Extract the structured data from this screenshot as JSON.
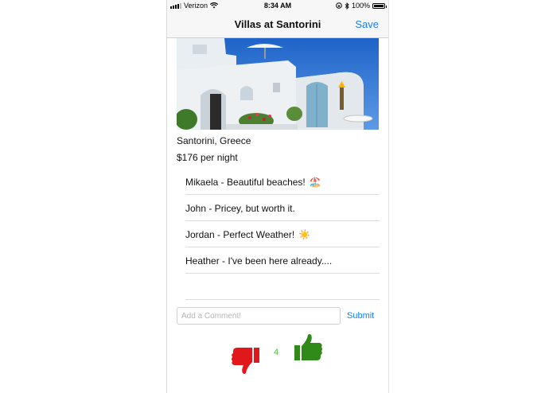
{
  "status_bar": {
    "carrier": "Verizon",
    "time": "8:34 AM",
    "battery": "100%"
  },
  "nav": {
    "title": "Villas at Santorini",
    "save_label": "Save"
  },
  "listing": {
    "location": "Santorini, Greece",
    "price": "$176 per night"
  },
  "comments": [
    {
      "text": "Mikaela - Beautiful beaches!",
      "emoji": "🏖️"
    },
    {
      "text": "John - Pricey, but worth it.",
      "emoji": ""
    },
    {
      "text": "Jordan - Perfect Weather!",
      "emoji": "☀️"
    },
    {
      "text": "Heather - I've been here already....",
      "emoji": ""
    }
  ],
  "comment_box": {
    "placeholder": "Add a Comment!",
    "submit_label": "Submit"
  },
  "votes": {
    "count": "4",
    "down_color": "#e0171b",
    "up_color": "#2f8a1a"
  },
  "icons": [
    "signal-icon",
    "wifi-icon",
    "lock-rotation-icon",
    "bluetooth-icon",
    "battery-icon",
    "thumbs-down-icon",
    "thumbs-up-icon"
  ]
}
